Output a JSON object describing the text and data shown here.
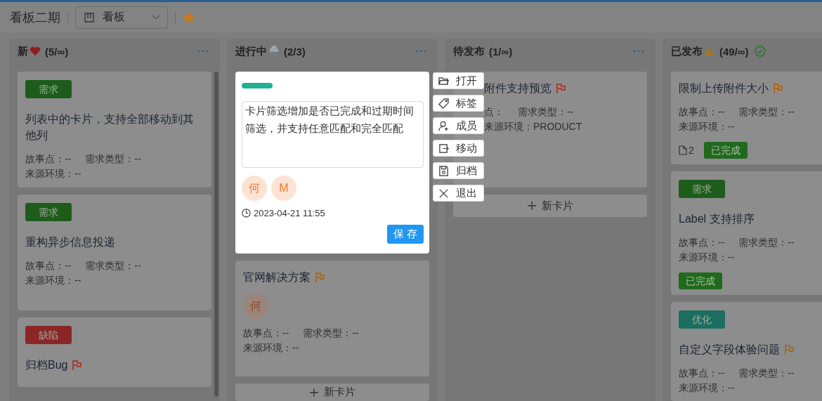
{
  "header": {
    "title": "看板二期",
    "view_select": {
      "value": "看板"
    },
    "starred": true
  },
  "columns": [
    {
      "title": "新",
      "kind": "heart",
      "count": "(5/∞)",
      "done": false,
      "scrollbar": true,
      "cards": [
        {
          "tag": {
            "label": "需求",
            "color": "#1e5c1c"
          },
          "title": "列表中的卡片，支持全部移动到其他列",
          "meta": [
            [
              "故事点：--",
              "需求类型：--"
            ],
            [
              "来源环境：--"
            ]
          ],
          "tall": true
        },
        {
          "tag": {
            "label": "需求",
            "color": "#1e5c1c"
          },
          "title": "重构异步信息投递",
          "meta": [
            [
              "故事点：--",
              "需求类型：--"
            ],
            [
              "来源环境：--"
            ]
          ],
          "tall": true
        },
        {
          "tag": {
            "label": "缺陷",
            "color": "#8c2626"
          },
          "title": "归档Bug",
          "flag": {
            "color": "#a8402f"
          }
        }
      ]
    },
    {
      "title": "进行中",
      "kind": "cloud",
      "count": "(2/3)",
      "done": false,
      "scrollbar": false,
      "editor": {
        "label": {
          "color": "#1fb092"
        },
        "text": "卡片筛选增加是否已完成和过期时间筛选，并支持任意匹配和完全匹配",
        "members": [
          "何",
          "M"
        ],
        "due": "2023-04-21 11:55",
        "save": "保 存"
      },
      "menu": [
        {
          "kind": "open",
          "label": "打开"
        },
        {
          "kind": "tag",
          "label": "标签"
        },
        {
          "kind": "member",
          "label": "成员"
        },
        {
          "kind": "move",
          "label": "移动"
        },
        {
          "kind": "archive",
          "label": "归档"
        },
        {
          "kind": "exit",
          "label": "退出"
        }
      ],
      "cards": [
        {
          "title": "官网解决方案",
          "flag": {
            "color": "#a86a1e"
          },
          "members": [
            "何"
          ],
          "meta": [
            [
              "故事点：--",
              "需求类型：--"
            ],
            [
              "来源环境：--"
            ]
          ],
          "tall": true
        }
      ],
      "new_card": "新卡片"
    },
    {
      "title": "待发布",
      "kind": "none",
      "count": "(1/∞)",
      "done": false,
      "scrollbar": false,
      "cards": [
        {
          "inset": true,
          "title": "附件支持预览",
          "flag": {
            "color": "#a8402f"
          },
          "meta": [
            [
              "点：",
              "需求类型：--"
            ],
            [
              "来源环境：PRODUCT"
            ]
          ],
          "tall": true
        }
      ],
      "new_card": "新卡片"
    },
    {
      "title": "已发布",
      "kind": "arm",
      "count": "(49/∞)",
      "done": true,
      "scrollbar": false,
      "cards": [
        {
          "title": "限制上传附件大小",
          "flag": {
            "color": "#a86a1e"
          },
          "meta": [
            [
              "故事点：--",
              "需求类型：--"
            ],
            [
              "来源环境：--"
            ]
          ],
          "attachments": "2",
          "status": "已完成"
        },
        {
          "tag": {
            "label": "需求",
            "color": "#1e5c1c"
          },
          "title": "Label 支持排序",
          "meta": [
            [
              "故事点：--",
              "需求类型：--"
            ],
            [
              "来源环境：--"
            ]
          ],
          "status": "已完成"
        },
        {
          "tag": {
            "label": "优化",
            "color": "#1b6e60"
          },
          "title": "自定义字段体验问题",
          "flag": {
            "color": "#a86a1e"
          },
          "meta": [
            [
              "故事点：--",
              "需求类型：--"
            ],
            [
              "来源环境：--"
            ]
          ]
        }
      ]
    }
  ]
}
